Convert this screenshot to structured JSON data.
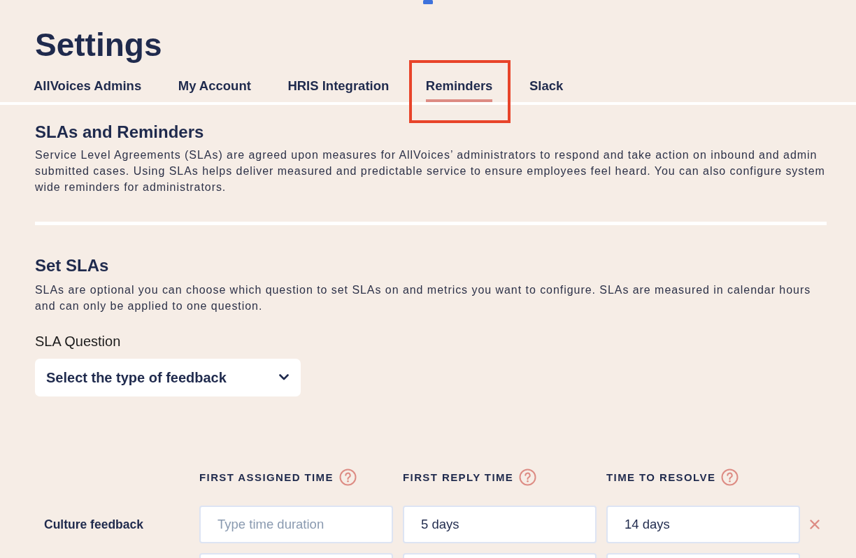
{
  "page": {
    "title": "Settings"
  },
  "tabs": [
    {
      "label": "AllVoices Admins",
      "selected": false,
      "highlighted": false
    },
    {
      "label": "My Account",
      "selected": false,
      "highlighted": false
    },
    {
      "label": "HRIS Integration",
      "selected": false,
      "highlighted": false
    },
    {
      "label": "Reminders",
      "selected": true,
      "highlighted": true
    },
    {
      "label": "Slack",
      "selected": false,
      "highlighted": false
    }
  ],
  "intro": {
    "heading": "SLAs and Reminders",
    "text": "Service Level Agreements (SLAs) are agreed upon measures for AllVoices’ administrators to respond and take action on inbound and admin submitted cases. Using SLAs helps deliver measured and predictable service to ensure employees feel heard. You can also configure system wide reminders for administrators."
  },
  "sla_section": {
    "heading": "Set SLAs",
    "text": "SLAs are optional you can choose which question to set SLAs on and metrics you want to configure. SLAs are measured in calendar hours and can only be applied to one question.",
    "question_label": "SLA Question",
    "question_select": {
      "value": "Select the type of feedback"
    }
  },
  "sla_table": {
    "columns": [
      {
        "label": "FIRST ASSIGNED TIME",
        "help": true
      },
      {
        "label": "FIRST REPLY TIME",
        "help": true
      },
      {
        "label": "TIME TO RESOLVE",
        "help": true
      }
    ],
    "rows": [
      {
        "label": "Culture feedback",
        "fields": [
          {
            "kind": "text_input",
            "placeholder": "Type time duration"
          },
          {
            "kind": "text_input",
            "value": "5 days"
          },
          {
            "kind": "text_input",
            "value": "14 days"
          }
        ],
        "removable": true
      },
      {
        "fields": [
          {
            "kind": "text_input"
          },
          {
            "kind": "text_input"
          },
          {
            "kind": "text_input"
          }
        ]
      }
    ]
  }
}
